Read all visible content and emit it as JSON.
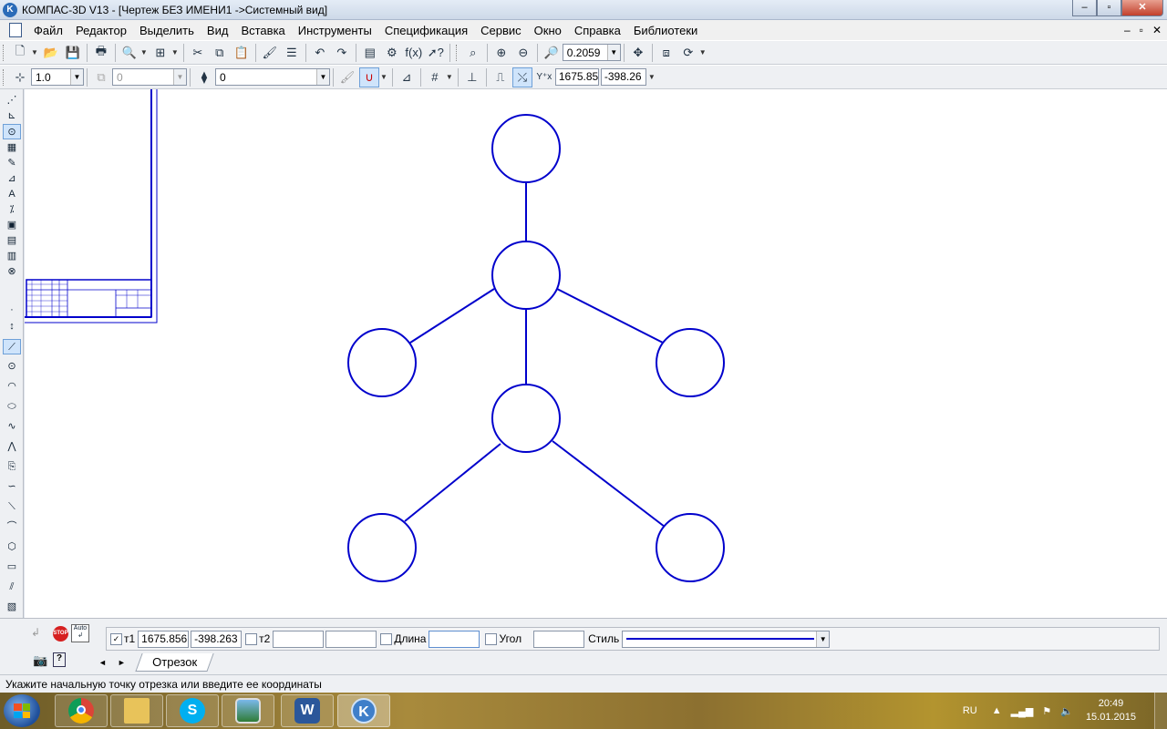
{
  "window": {
    "title": "КОМПАС-3D V13 - [Чертеж БЕЗ ИМЕНИ1 ->Системный вид]",
    "app_icon_letter": "K",
    "minimize": "–",
    "maximize": "▫",
    "close": "✕"
  },
  "menu": {
    "items": [
      "Файл",
      "Редактор",
      "Выделить",
      "Вид",
      "Вставка",
      "Инструменты",
      "Спецификация",
      "Сервис",
      "Окно",
      "Справка",
      "Библиотеки"
    ],
    "mdi_min": "–",
    "mdi_restore": "▫",
    "mdi_close": "✕"
  },
  "toolbar1": {
    "zoom_value": "0.2059"
  },
  "toolbar2": {
    "line_step": "1.0",
    "layer_disabled": "0",
    "layer_value": "0",
    "coord_x": "1675.85",
    "coord_y": "-398.26"
  },
  "property_bar": {
    "t1_label": "т1",
    "t1_x": "1675.856",
    "t1_y": "-398.263",
    "t2_label": "т2",
    "t2_x": "",
    "t2_y": "",
    "length_label": "Длина",
    "length_value": "",
    "angle_label": "Угол",
    "angle_value": "",
    "style_label": "Стиль",
    "tab_label": "Отрезок",
    "auto_label": "Auto",
    "stop_label": "STOP"
  },
  "status_text": "Укажите начальную точку отрезка или введите ее координаты",
  "tray": {
    "lang": "RU",
    "time": "20:49",
    "date": "15.01.2015"
  },
  "taskbar_apps": [
    "chrome-icon",
    "explorer-icon",
    "skype-icon",
    "image-viewer-icon",
    "word-icon",
    "kompas-icon"
  ],
  "colors": {
    "drawing_line": "#0000cc",
    "taskbar": "#8c7030"
  }
}
